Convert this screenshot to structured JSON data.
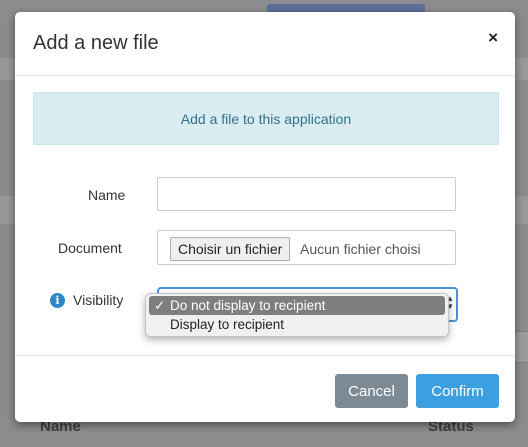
{
  "background": {
    "table_headers": [
      "Name",
      "Status"
    ]
  },
  "modal": {
    "title": "Add a new file",
    "close_icon": "×",
    "info_message": "Add a file to this application",
    "fields": {
      "name_label": "Name",
      "name_value": "",
      "document_label": "Document",
      "file_button": "Choisir un fichier",
      "file_status": "Aucun fichier choisi",
      "visibility_label": "Visibility",
      "visibility_options": [
        "Do not display to recipient",
        "Display to recipient"
      ],
      "visibility_selected": "Do not display to recipient"
    },
    "buttons": {
      "cancel": "Cancel",
      "confirm": "Confirm"
    },
    "colors": {
      "info_bg": "#d9edf1",
      "info_text": "#31708f",
      "confirm_bg": "#3c9fdf",
      "cancel_bg": "#7c8a96",
      "focus_border": "#4a8fe0"
    },
    "icons": {
      "info": "info-circle-icon",
      "close": "close-icon",
      "check": "checkmark-icon",
      "select_arrows": "updown-arrows-icon"
    }
  }
}
